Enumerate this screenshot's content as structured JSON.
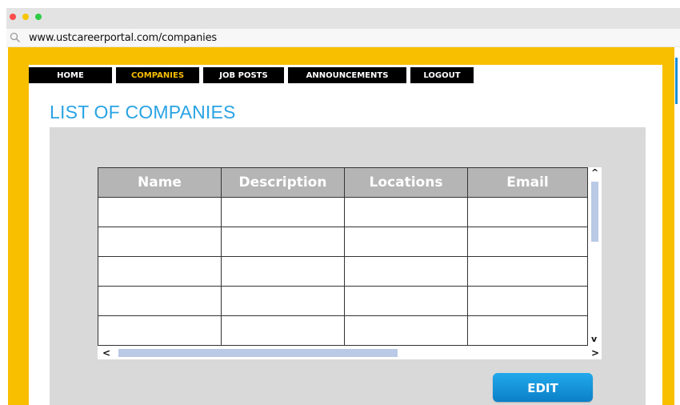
{
  "browser": {
    "url": "www.ustcareerportal.com/companies"
  },
  "nav": {
    "items": [
      {
        "label": "HOME"
      },
      {
        "label": "COMPANIES"
      },
      {
        "label": "JOB POSTS"
      },
      {
        "label": "ANNOUNCEMENTS"
      },
      {
        "label": "LOGOUT"
      }
    ],
    "active": "COMPANIES"
  },
  "page": {
    "title": "LIST OF COMPANIES"
  },
  "table": {
    "columns": [
      "Name",
      "Description",
      "Locations",
      "Email"
    ],
    "rows": [
      [
        "",
        "",
        "",
        ""
      ],
      [
        "",
        "",
        "",
        ""
      ],
      [
        "",
        "",
        "",
        ""
      ],
      [
        "",
        "",
        "",
        ""
      ],
      [
        "",
        "",
        "",
        ""
      ]
    ],
    "scroll_up": "^",
    "scroll_down": "v",
    "scroll_left": "<",
    "scroll_right": ">"
  },
  "actions": {
    "edit_label": "EDIT"
  },
  "colors": {
    "frame": "#f8bf00",
    "accent": "#29a3e4",
    "nav_bg": "#000000",
    "active_nav": "#f8bf00",
    "header_bg": "#b5b5b5",
    "button": "#1a96dd"
  },
  "icons": {
    "address_bar": "search-icon"
  }
}
